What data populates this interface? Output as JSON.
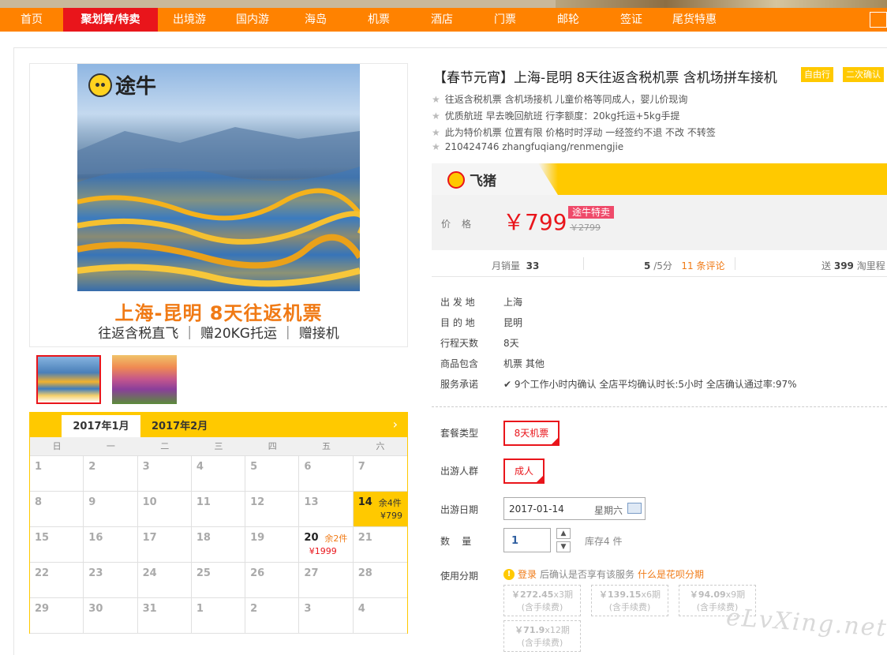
{
  "nav": {
    "items": [
      "首页",
      "聚划算/特卖",
      "出境游",
      "国内游",
      "海岛",
      "机票",
      "酒店",
      "门票",
      "邮轮",
      "签证",
      "尾货特惠"
    ],
    "active_index": 1
  },
  "product": {
    "hero_logo": "途牛",
    "banner_title": "上海-昆明  8天往返机票",
    "banner_sub": "往返含税直飞 ｜ 赠20KG托运 ｜ 赠接机",
    "title": "【春节元宵】上海-昆明 8天往返含税机票 含机场拼车接机",
    "badges": [
      "自由行",
      "二次确认"
    ],
    "features": [
      "往返含税机票 含机场接机 儿童价格等同成人，婴儿价现询",
      "优质航班 早去晚回航班 行李额度：20kg托运+5kg手提",
      "此为特价机票 位置有限 价格时时浮动 一经签约不退 不改 不转签",
      "210424746 zhangfuqiang/renmengjie"
    ]
  },
  "fliggy": {
    "logo_text": "飞猪"
  },
  "price": {
    "label": "价格",
    "current": "￥799",
    "tag": "途牛特卖",
    "original": "￥2799"
  },
  "stats": {
    "monthly_sales_label": "月销量",
    "monthly_sales": "33",
    "rating": "5",
    "rating_suffix": "/5分",
    "reviews_count": "11",
    "reviews_label": "条评论",
    "points_prefix": "送",
    "points": "399",
    "points_suffix": "淘里程"
  },
  "details": [
    {
      "label": "出 发 地",
      "value": "上海"
    },
    {
      "label": "目 的 地",
      "value": "昆明"
    },
    {
      "label": "行程天数",
      "value": "8天"
    },
    {
      "label": "商品包含",
      "value": "机票  其他"
    },
    {
      "label": "服务承诺",
      "value": "9个工作小时内确认    全店平均确认时长:5小时    全店确认通过率:97%"
    }
  ],
  "options": {
    "package_label": "套餐类型",
    "package_value": "8天机票",
    "traveler_label": "出游人群",
    "traveler_value": "成人",
    "date_label": "出游日期",
    "date_value": "2017-01-14",
    "weekday_value": "星期六",
    "qty_label": "数    量",
    "qty_value": "1",
    "stock": "库存4 件",
    "installment_label": "使用分期",
    "installment_note_link": "登录",
    "installment_note": "后确认是否享有该服务",
    "installment_help": "什么是花呗分期",
    "installments": [
      {
        "amount": "￥272.45",
        "period": "x3期",
        "fee": "(含手续费)"
      },
      {
        "amount": "￥139.15",
        "period": "x6期",
        "fee": "(含手续费)"
      },
      {
        "amount": "￥94.09",
        "period": "x9期",
        "fee": "(含手续费)"
      },
      {
        "amount": "￥71.9",
        "period": "x12期",
        "fee": "(含手续费)"
      }
    ]
  },
  "calendar": {
    "month_tabs": [
      "2017年1月",
      "2017年2月"
    ],
    "weekdays": [
      "日",
      "一",
      "二",
      "三",
      "四",
      "五",
      "六"
    ],
    "days": [
      {
        "d": "1"
      },
      {
        "d": "2"
      },
      {
        "d": "3"
      },
      {
        "d": "4"
      },
      {
        "d": "5"
      },
      {
        "d": "6"
      },
      {
        "d": "7"
      },
      {
        "d": "8"
      },
      {
        "d": "9"
      },
      {
        "d": "10"
      },
      {
        "d": "11"
      },
      {
        "d": "12"
      },
      {
        "d": "13"
      },
      {
        "d": "14",
        "rem": "余4件",
        "price": "¥799",
        "state": "hl"
      },
      {
        "d": "15"
      },
      {
        "d": "16"
      },
      {
        "d": "17"
      },
      {
        "d": "18"
      },
      {
        "d": "19"
      },
      {
        "d": "20",
        "rem": "余2件",
        "price": "¥1999",
        "state": "avail"
      },
      {
        "d": "21"
      },
      {
        "d": "22"
      },
      {
        "d": "23"
      },
      {
        "d": "24"
      },
      {
        "d": "25"
      },
      {
        "d": "26"
      },
      {
        "d": "27"
      },
      {
        "d": "28"
      },
      {
        "d": "29"
      },
      {
        "d": "30"
      },
      {
        "d": "31"
      },
      {
        "d": "1"
      },
      {
        "d": "2"
      },
      {
        "d": "3"
      },
      {
        "d": "4"
      }
    ]
  },
  "watermark": "eLvXing.net",
  "colors": {
    "nav": "#ff8200",
    "nav_active": "#e9151b",
    "accent": "#ffc900",
    "price": "#e9151b"
  }
}
